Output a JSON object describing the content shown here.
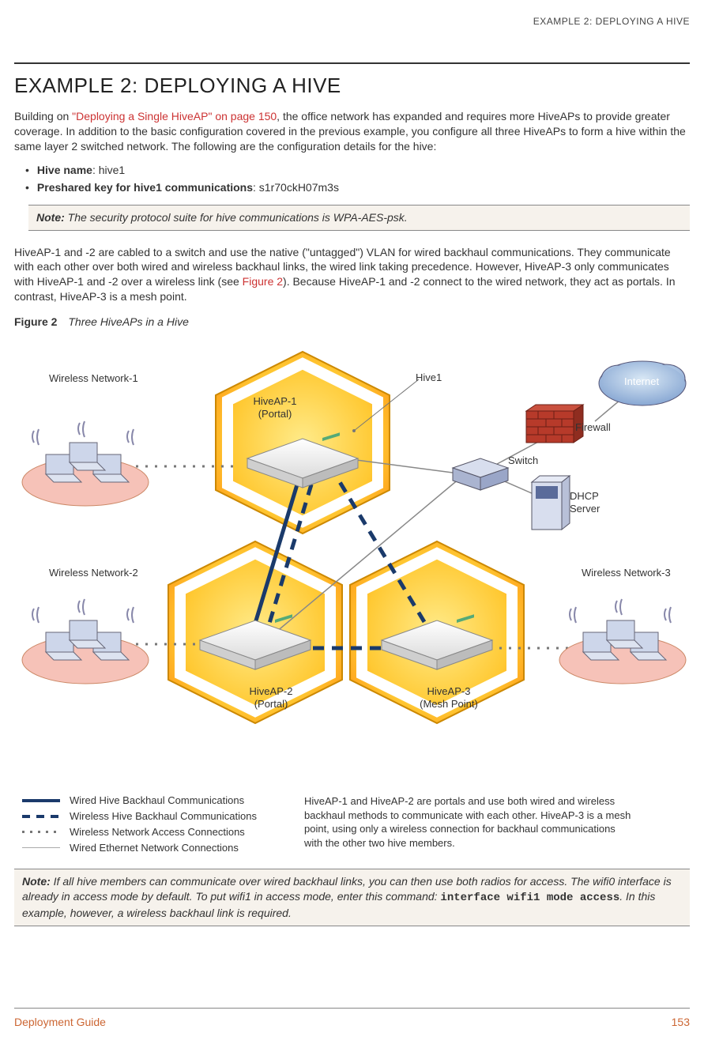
{
  "header": {
    "running_head": "EXAMPLE 2: DEPLOYING A HIVE"
  },
  "title": "EXAMPLE 2: DEPLOYING A HIVE",
  "intro_before_link": "Building on ",
  "intro_link": "\"Deploying a Single HiveAP\" on page 150",
  "intro_after_link": ", the office network has expanded and requires more HiveAPs to provide greater coverage. In addition to the basic configuration covered in the previous example, you configure all three HiveAPs to form a hive within the same layer 2 switched network. The following are the configuration details for the hive:",
  "bullets": [
    {
      "label": "Hive name",
      "value": ": hive1"
    },
    {
      "label": "Preshared key for hive1 communications",
      "value": ": s1r70ckH07m3s"
    }
  ],
  "note1_label": "Note:",
  "note1_text": " The security protocol suite for hive communications is WPA-AES-psk.",
  "para2_a": "HiveAP-1 and -2 are cabled to a switch and use the native (\"untagged\") VLAN for wired backhaul communications. They communicate with each other over both wired and wireless backhaul links, the wired link taking precedence. However, HiveAP-3 only communicates with HiveAP-1 and -2 over a wireless link (see ",
  "para2_link": "Figure 2",
  "para2_b": "). Because HiveAP-1 and -2 connect to the wired network, they act as portals. In contrast, HiveAP-3 is a mesh point.",
  "figure": {
    "label": "Figure 2",
    "title": "Three HiveAPs in a Hive"
  },
  "diagram": {
    "wireless_net1": "Wireless Network-1",
    "wireless_net2": "Wireless Network-2",
    "wireless_net3": "Wireless Network-3",
    "hive1": "Hive1",
    "internet": "Internet",
    "firewall": "Firewall",
    "switch": "Switch",
    "dhcp": "DHCP\nServer",
    "ap1": "HiveAP-1\n(Portal)",
    "ap2": "HiveAP-2\n(Portal)",
    "ap3": "HiveAP-3\n(Mesh Point)"
  },
  "legend": {
    "items": [
      "Wired Hive Backhaul Communications",
      "Wireless Hive Backhaul Communications",
      "Wireless Network Access Connections",
      "Wired Ethernet Network Connections"
    ],
    "desc": "HiveAP-1 and HiveAP-2 are portals and use both wired and wireless backhaul methods to communicate with each other. HiveAP-3 is a mesh point, using only a wireless connection for backhaul communications with the other two hive members."
  },
  "note2_label": "Note:",
  "note2_text_a": " If all hive members can communicate over wired backhaul links, you can then use both radios for access. The wifi0 interface is already in access mode by default. To put wifi1 in access mode, enter this command: ",
  "note2_cmd": "interface wifi1 mode access",
  "note2_text_b": ". In this example, however, a wireless backhaul link is required.",
  "footer": {
    "left": "Deployment Guide",
    "right": "153"
  }
}
